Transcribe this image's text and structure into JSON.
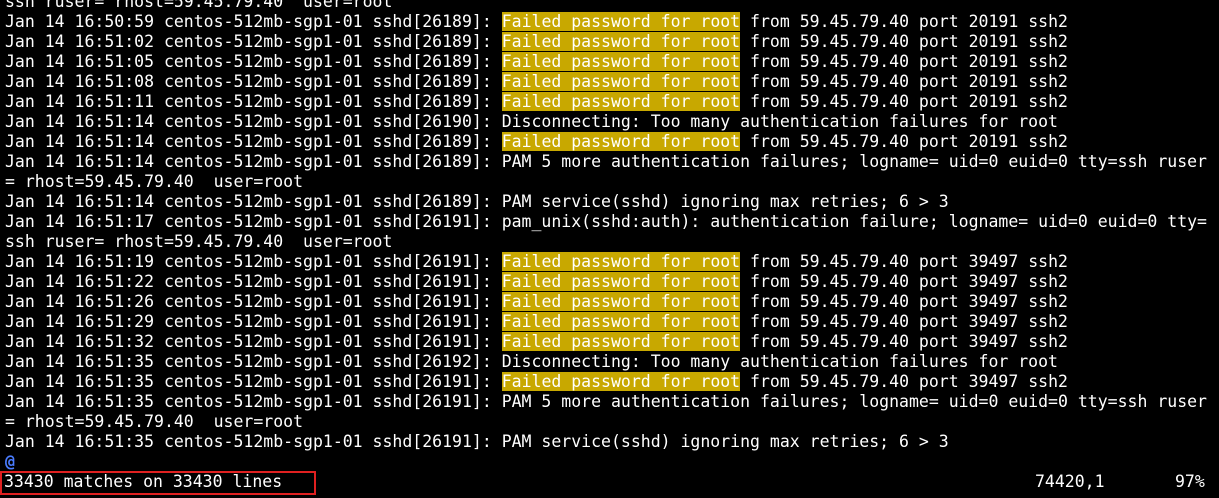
{
  "terminal": {
    "lines": [
      {
        "pre": "ssh ruser= rhost=59.45.79.40  user=root",
        "hl": "",
        "post": ""
      },
      {
        "pre": "Jan 14 16:50:59 centos-512mb-sgp1-01 sshd[26189]: ",
        "hl": "Failed password for root",
        "post": " from 59.45.79.40 port 20191 ssh2"
      },
      {
        "pre": "Jan 14 16:51:02 centos-512mb-sgp1-01 sshd[26189]: ",
        "hl": "Failed password for root",
        "post": " from 59.45.79.40 port 20191 ssh2"
      },
      {
        "pre": "Jan 14 16:51:05 centos-512mb-sgp1-01 sshd[26189]: ",
        "hl": "Failed password for root",
        "post": " from 59.45.79.40 port 20191 ssh2"
      },
      {
        "pre": "Jan 14 16:51:08 centos-512mb-sgp1-01 sshd[26189]: ",
        "hl": "Failed password for root",
        "post": " from 59.45.79.40 port 20191 ssh2"
      },
      {
        "pre": "Jan 14 16:51:11 centos-512mb-sgp1-01 sshd[26189]: ",
        "hl": "Failed password for root",
        "post": " from 59.45.79.40 port 20191 ssh2"
      },
      {
        "pre": "Jan 14 16:51:14 centos-512mb-sgp1-01 sshd[26190]: Disconnecting: Too many authentication failures for root",
        "hl": "",
        "post": ""
      },
      {
        "pre": "Jan 14 16:51:14 centos-512mb-sgp1-01 sshd[26189]: ",
        "hl": "Failed password for root",
        "post": " from 59.45.79.40 port 20191 ssh2"
      },
      {
        "pre": "Jan 14 16:51:14 centos-512mb-sgp1-01 sshd[26189]: PAM 5 more authentication failures; logname= uid=0 euid=0 tty=ssh ruser",
        "hl": "",
        "post": ""
      },
      {
        "pre": "= rhost=59.45.79.40  user=root",
        "hl": "",
        "post": ""
      },
      {
        "pre": "Jan 14 16:51:14 centos-512mb-sgp1-01 sshd[26189]: PAM service(sshd) ignoring max retries; 6 > 3",
        "hl": "",
        "post": ""
      },
      {
        "pre": "Jan 14 16:51:17 centos-512mb-sgp1-01 sshd[26191]: pam_unix(sshd:auth): authentication failure; logname= uid=0 euid=0 tty=",
        "hl": "",
        "post": ""
      },
      {
        "pre": "ssh ruser= rhost=59.45.79.40  user=root",
        "hl": "",
        "post": ""
      },
      {
        "pre": "Jan 14 16:51:19 centos-512mb-sgp1-01 sshd[26191]: ",
        "hl": "Failed password for root",
        "post": " from 59.45.79.40 port 39497 ssh2"
      },
      {
        "pre": "Jan 14 16:51:22 centos-512mb-sgp1-01 sshd[26191]: ",
        "hl": "Failed password for root",
        "post": " from 59.45.79.40 port 39497 ssh2"
      },
      {
        "pre": "Jan 14 16:51:26 centos-512mb-sgp1-01 sshd[26191]: ",
        "hl": "Failed password for root",
        "post": " from 59.45.79.40 port 39497 ssh2"
      },
      {
        "pre": "Jan 14 16:51:29 centos-512mb-sgp1-01 sshd[26191]: ",
        "hl": "Failed password for root",
        "post": " from 59.45.79.40 port 39497 ssh2"
      },
      {
        "pre": "Jan 14 16:51:32 centos-512mb-sgp1-01 sshd[26191]: ",
        "hl": "Failed password for root",
        "post": " from 59.45.79.40 port 39497 ssh2"
      },
      {
        "pre": "Jan 14 16:51:35 centos-512mb-sgp1-01 sshd[26192]: Disconnecting: Too many authentication failures for root",
        "hl": "",
        "post": ""
      },
      {
        "pre": "Jan 14 16:51:35 centos-512mb-sgp1-01 sshd[26191]: ",
        "hl": "Failed password for root",
        "post": " from 59.45.79.40 port 39497 ssh2"
      },
      {
        "pre": "Jan 14 16:51:35 centos-512mb-sgp1-01 sshd[26191]: PAM 5 more authentication failures; logname= uid=0 euid=0 tty=ssh ruser",
        "hl": "",
        "post": ""
      },
      {
        "pre": "= rhost=59.45.79.40  user=root",
        "hl": "",
        "post": ""
      },
      {
        "pre": "Jan 14 16:51:35 centos-512mb-sgp1-01 sshd[26191]: PAM service(sshd) ignoring max retries; 6 > 3",
        "hl": "",
        "post": ""
      }
    ],
    "end_of_buffer": "@"
  },
  "status": {
    "message": "33430 matches on 33430 lines",
    "position": "74420,1",
    "percent": "97%"
  },
  "colors": {
    "background": "#000000",
    "text": "#ffffff",
    "search_highlight": "#c8a800",
    "eob_marker": "#4a7cff",
    "annotation_box": "#e02020"
  }
}
